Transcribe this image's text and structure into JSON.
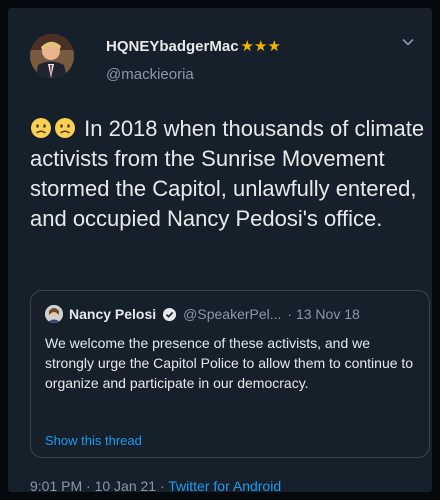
{
  "tweet": {
    "display_name": "HQNEYbadgerMac",
    "stars": "★★★",
    "handle": "@mackieoria",
    "text": "In 2018 when thousands of climate activists from the Sunrise Movement stormed the Capitol, unlawfully entered, and occupied Nancy Pedosi's office.",
    "emoji_icons": [
      "worried-face-icon",
      "worried-face-icon"
    ]
  },
  "quoted": {
    "name": "Nancy Pelosi",
    "handle": "@SpeakerPel...",
    "date": "· 13 Nov 18",
    "text": "We welcome the presence of these activists, and we strongly urge the Capitol Police to allow them to continue to organize and participate in our democracy.",
    "show_thread": "Show this thread"
  },
  "footer": {
    "time_date": "9:01 PM · 10 Jan 21 ·",
    "app": "Twitter for Android"
  },
  "colors": {
    "background": "#15202b",
    "text": "#e7e9ea",
    "muted": "#8b98a5",
    "link": "#1d9bf0",
    "stars": "#f4b400"
  }
}
